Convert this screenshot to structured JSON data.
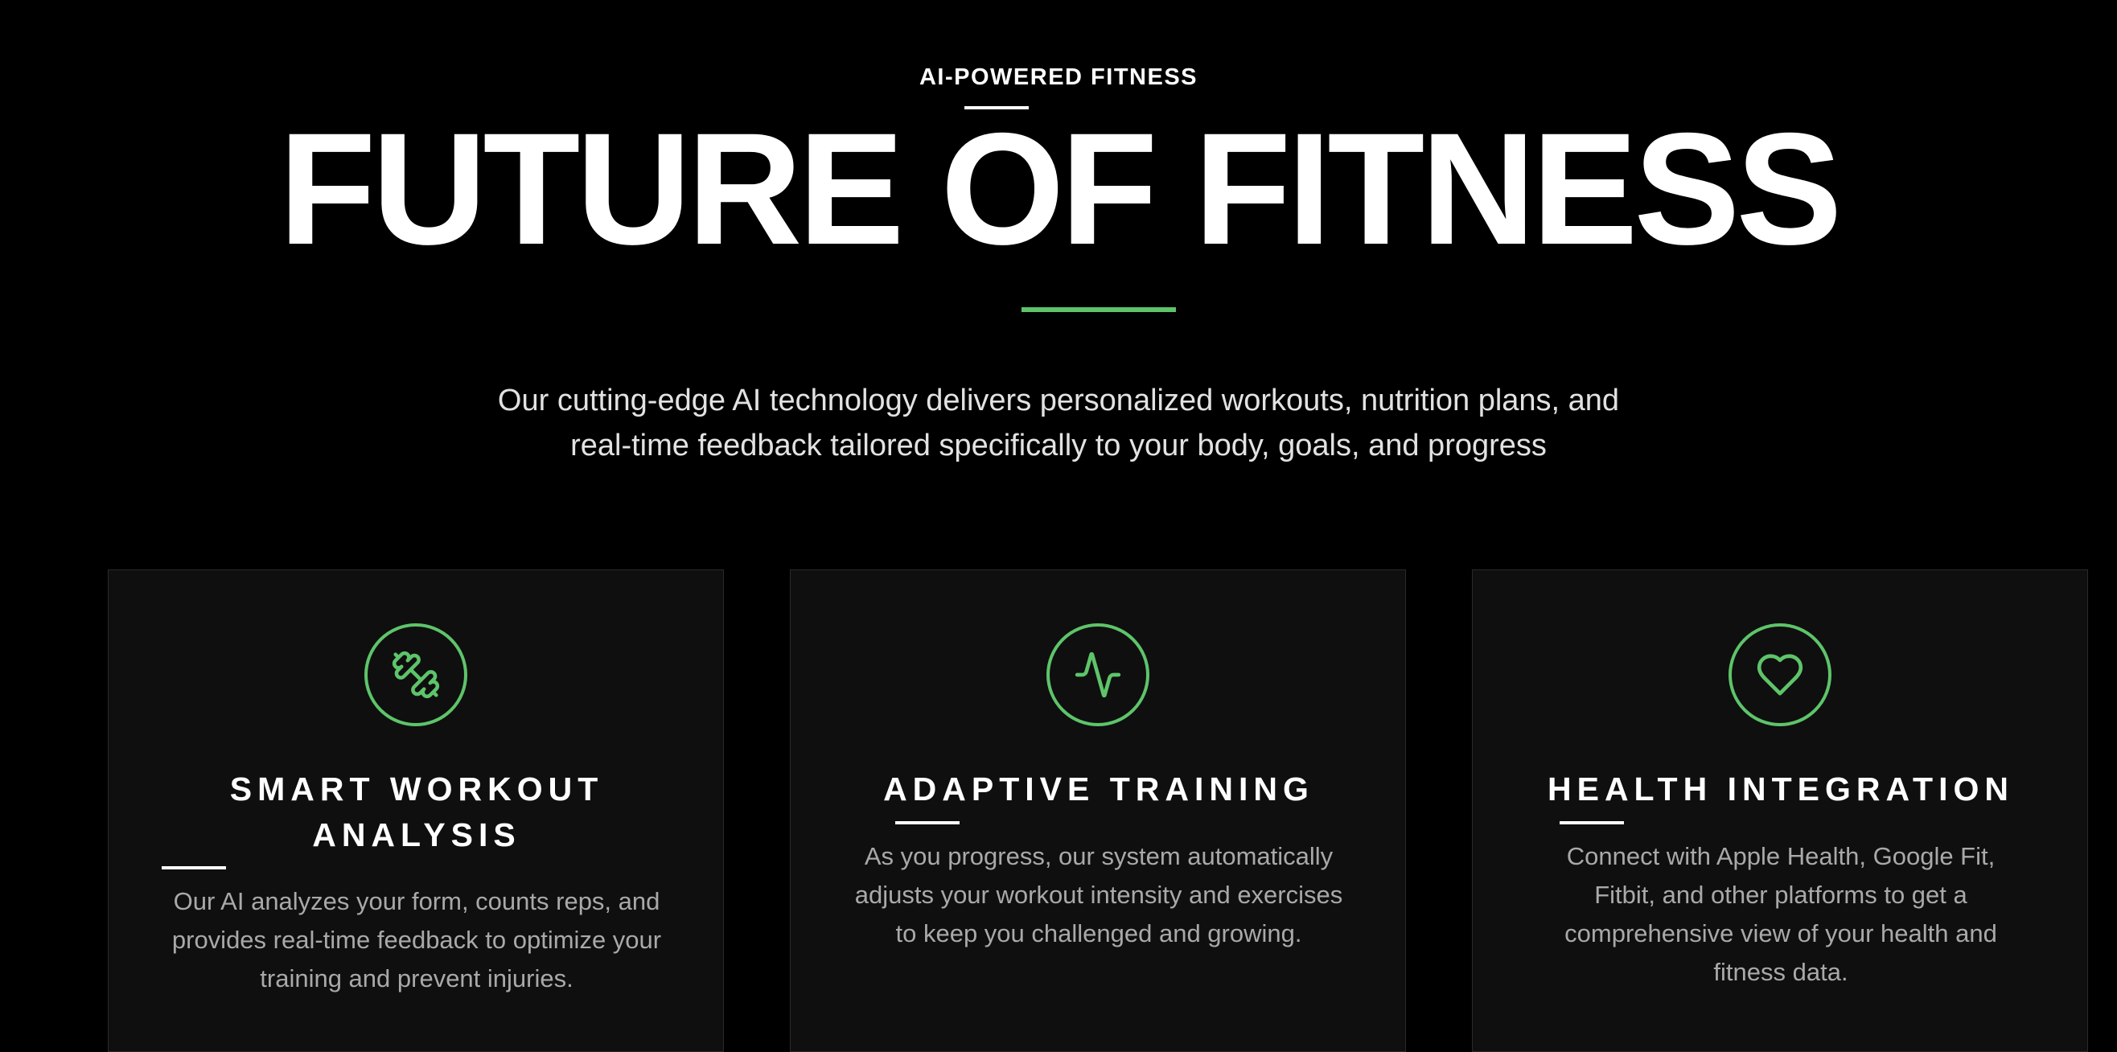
{
  "colors": {
    "background": "#000000",
    "card_background": "#0f0f0f",
    "accent": "#5ec46a",
    "heading": "#ffffff",
    "body_text": "#a9a9a9"
  },
  "hero": {
    "eyebrow": "AI-POWERED FITNESS",
    "title": "FUTURE OF FITNESS",
    "description_lines": [
      "Our cutting-edge AI technology delivers personalized workouts, nutrition plans, and",
      "real-time feedback tailored specifically to your body, goals, and progress"
    ]
  },
  "features": [
    {
      "icon": "dumbbell-icon",
      "title_lines": [
        "SMART WORKOUT",
        "ANALYSIS"
      ],
      "description_lines": [
        "Our AI analyzes your form, counts reps, and",
        "provides real-time feedback to optimize your",
        "training and prevent injuries."
      ]
    },
    {
      "icon": "activity-pulse-icon",
      "title_lines": [
        "ADAPTIVE TRAINING"
      ],
      "description_lines": [
        "As you progress, our system automatically",
        "adjusts your workout intensity and exercises",
        "to keep you challenged and growing."
      ]
    },
    {
      "icon": "heart-icon",
      "title_lines": [
        "HEALTH INTEGRATION"
      ],
      "description_lines": [
        "Connect with Apple Health, Google Fit,",
        "Fitbit, and other platforms to get a",
        "comprehensive view of your health and",
        "fitness data."
      ]
    }
  ]
}
